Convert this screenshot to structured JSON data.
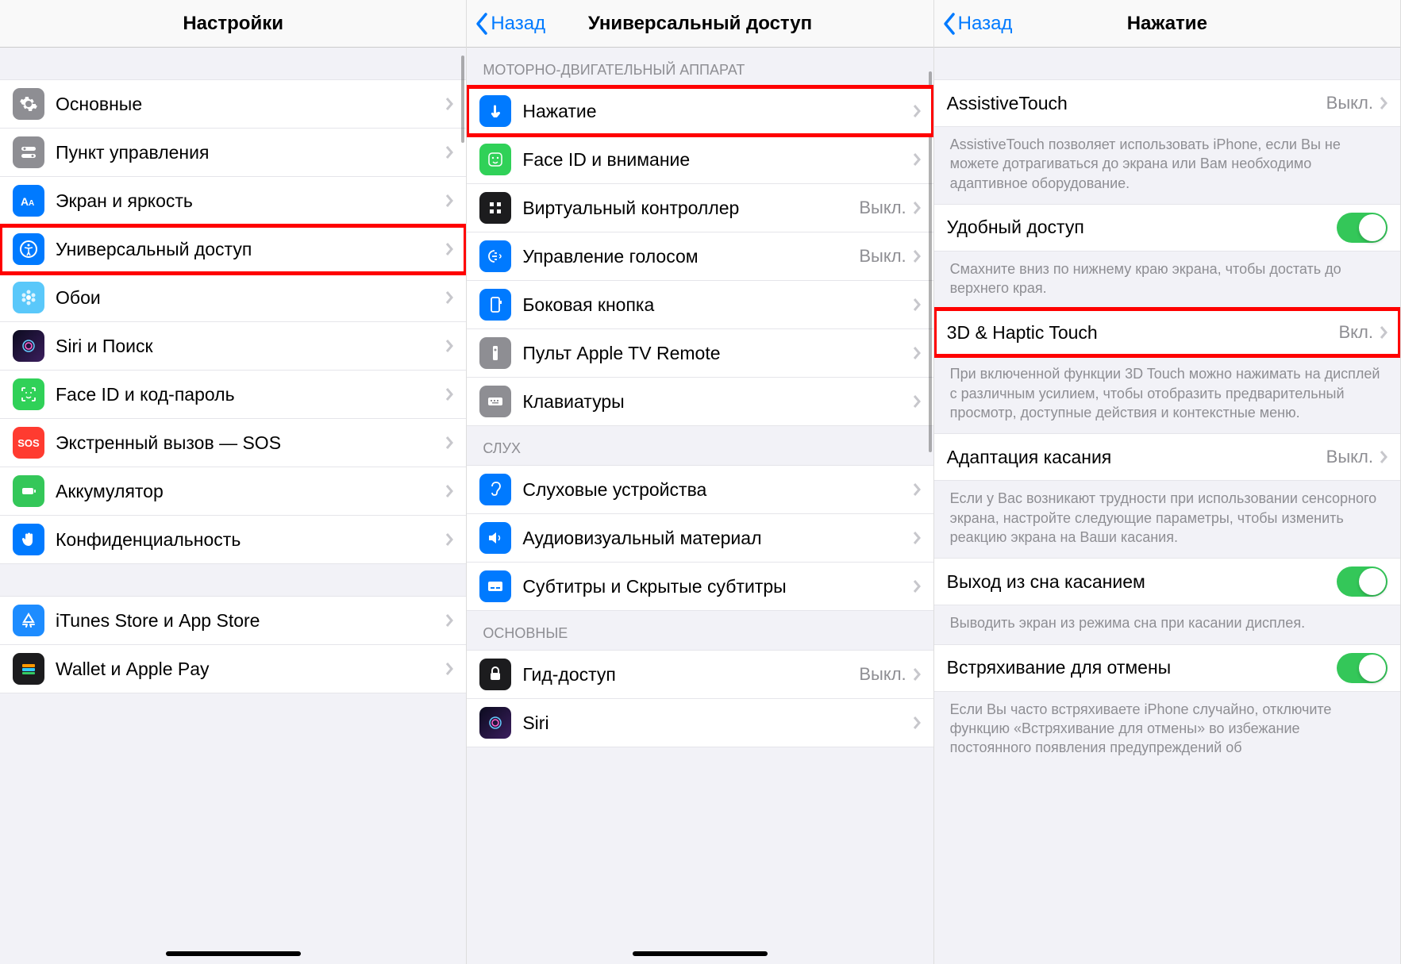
{
  "panel1": {
    "title": "Настройки",
    "items": [
      {
        "label": "Основные",
        "icon": "general"
      },
      {
        "label": "Пункт управления",
        "icon": "control"
      },
      {
        "label": "Экран и яркость",
        "icon": "display"
      },
      {
        "label": "Универсальный доступ",
        "icon": "accessibility",
        "highlight": true
      },
      {
        "label": "Обои",
        "icon": "wallpaper"
      },
      {
        "label": "Siri и Поиск",
        "icon": "siri"
      },
      {
        "label": "Face ID и код-пароль",
        "icon": "faceid"
      },
      {
        "label": "Экстренный вызов — SOS",
        "icon": "sos"
      },
      {
        "label": "Аккумулятор",
        "icon": "battery"
      },
      {
        "label": "Конфиденциальность",
        "icon": "privacy"
      }
    ],
    "items2": [
      {
        "label": "iTunes Store и App Store",
        "icon": "appstore"
      },
      {
        "label": "Wallet и Apple Pay",
        "icon": "wallet"
      }
    ]
  },
  "panel2": {
    "back": "Назад",
    "title": "Универсальный доступ",
    "section1_header": "МОТОРНО-ДВИГАТЕЛЬНЫЙ АППАРАТ",
    "section1": [
      {
        "label": "Нажатие",
        "icon": "touch",
        "highlight": true
      },
      {
        "label": "Face ID и внимание",
        "icon": "face"
      },
      {
        "label": "Виртуальный контроллер",
        "icon": "switch",
        "value": "Выкл."
      },
      {
        "label": "Управление голосом",
        "icon": "voice",
        "value": "Выкл."
      },
      {
        "label": "Боковая кнопка",
        "icon": "side"
      },
      {
        "label": "Пульт Apple TV Remote",
        "icon": "remote"
      },
      {
        "label": "Клавиатуры",
        "icon": "keyboard"
      }
    ],
    "section2_header": "СЛУХ",
    "section2": [
      {
        "label": "Слуховые устройства",
        "icon": "hearing"
      },
      {
        "label": "Аудиовизуальный материал",
        "icon": "audiodesc"
      },
      {
        "label": "Субтитры и Скрытые субтитры",
        "icon": "subtitles"
      }
    ],
    "section3_header": "ОСНОВНЫЕ",
    "section3": [
      {
        "label": "Гид-доступ",
        "icon": "guided",
        "value": "Выкл."
      },
      {
        "label": "Siri",
        "icon": "siri"
      }
    ]
  },
  "panel3": {
    "back": "Назад",
    "title": "Нажатие",
    "row1": {
      "label": "AssistiveTouch",
      "value": "Выкл."
    },
    "footer1": "AssistiveTouch позволяет использовать iPhone, если Вы не можете дотрагиваться до экрана или Вам необходимо адаптивное оборудование.",
    "row2": {
      "label": "Удобный доступ"
    },
    "footer2": "Смахните вниз по нижнему краю экрана, чтобы достать до верхнего края.",
    "row3": {
      "label": "3D & Haptic Touch",
      "value": "Вкл.",
      "highlight": true
    },
    "footer3": "При включенной функции 3D Touch можно нажимать на дисплей с различным усилием, чтобы отобразить предварительный просмотр, доступные действия и контекстные меню.",
    "row4": {
      "label": "Адаптация касания",
      "value": "Выкл."
    },
    "footer4": "Если у Вас возникают трудности при использовании сенсорного экрана, настройте следующие параметры, чтобы изменить реакцию экрана на Ваши касания.",
    "row5": {
      "label": "Выход из сна касанием"
    },
    "footer5": "Выводить экран из режима сна при касании дисплея.",
    "row6": {
      "label": "Встряхивание для отмены"
    },
    "footer6": "Если Вы часто встряхиваете iPhone случайно, отключите функцию «Встряхивание для отмены» во избежание постоянного появления предупреждений об"
  }
}
